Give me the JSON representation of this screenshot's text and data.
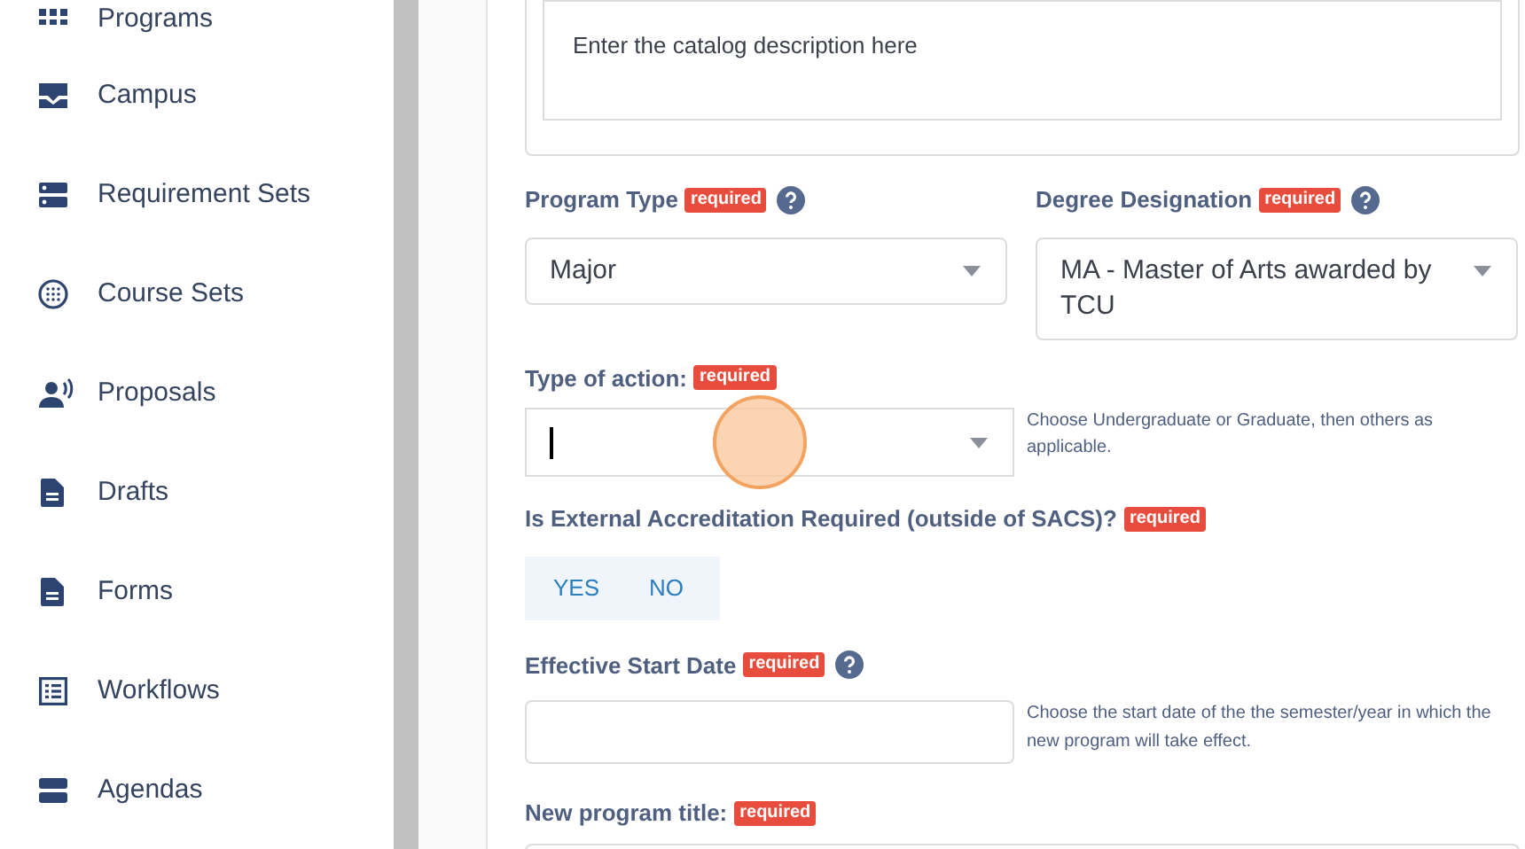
{
  "sidebar": {
    "items": [
      {
        "label": "Programs",
        "kind": "grid"
      },
      {
        "label": "Campus",
        "kind": "inbox"
      },
      {
        "label": "Requirement Sets",
        "kind": "server"
      },
      {
        "label": "Course Sets",
        "kind": "circle-dots"
      },
      {
        "label": "Proposals",
        "kind": "speaker"
      },
      {
        "label": "Drafts",
        "kind": "file"
      },
      {
        "label": "Forms",
        "kind": "file"
      },
      {
        "label": "Workflows",
        "kind": "list"
      },
      {
        "label": "Agendas",
        "kind": "bars"
      }
    ]
  },
  "description": {
    "placeholder": "Enter the catalog description here"
  },
  "fields_row": [
    {
      "label": "Program Type",
      "badge": "required",
      "help": true,
      "value": "Major"
    },
    {
      "label": "Degree Designation",
      "badge": "required",
      "help": true,
      "value": "MA - Master of Arts awarded by TCU"
    }
  ],
  "type_of_action": {
    "label": "Type of action:",
    "badge": "required",
    "focused": true,
    "click_marker": true,
    "hint": "Choose Undergraduate or Graduate, then others as applicable."
  },
  "accreditation": {
    "label": "Is External Accreditation Required (outside of SACS)?",
    "badge": "required",
    "options": [
      {
        "label": "YES",
        "selected": false
      },
      {
        "label": "NO",
        "selected": false
      }
    ]
  },
  "start_date": {
    "label": "Effective Start Date",
    "badge": "required",
    "help": true,
    "hint": "Choose the start date of the the semester/year in which the new program will take effect."
  },
  "program_title": {
    "label": "New program title:",
    "badge": "required"
  }
}
